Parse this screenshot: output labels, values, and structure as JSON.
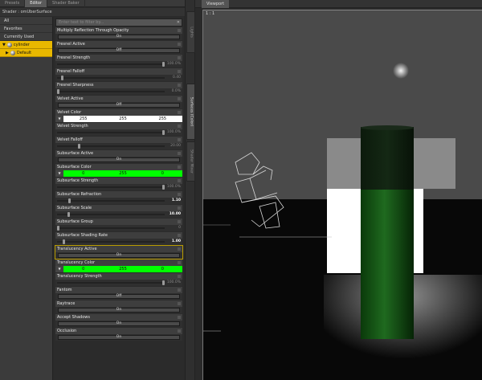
{
  "tabs": [
    {
      "label": "Presets",
      "active": false
    },
    {
      "label": "Editor",
      "active": true
    },
    {
      "label": "Shader Baker",
      "active": false
    }
  ],
  "shader_label": "Shader : omUberSurface",
  "categories": {
    "all": "All",
    "favorites": "Favorites",
    "currently_used": "Currently Used",
    "tree_root": "cylinder",
    "tree_child": "Default"
  },
  "search": {
    "placeholder": "Enter text to filter by..."
  },
  "props": {
    "multiply_reflection": {
      "label": "Multiply Reflection Through Opacity",
      "value": "On"
    },
    "fresnel_active": {
      "label": "Fresnel Active",
      "value": "Off"
    },
    "fresnel_strength": {
      "label": "Fresnel Strength",
      "value": "100.0%",
      "level": 1.0
    },
    "fresnel_falloff": {
      "label": "Fresnel Falloff",
      "value": "0.40",
      "level": 0.04
    },
    "fresnel_sharpness": {
      "label": "Fresnel Sharpness",
      "value": "0.0%",
      "level": 0.0
    },
    "velvet_active": {
      "label": "Velvet Active",
      "value": "Off"
    },
    "velvet_color": {
      "label": "Velvet Color",
      "r": "255",
      "g": "255",
      "b": "255",
      "hex": "#ffffff"
    },
    "velvet_strength": {
      "label": "Velvet Strength",
      "value": "100.0%",
      "level": 1.0
    },
    "velvet_falloff": {
      "label": "Velvet Falloff",
      "value": "20.00",
      "level": 0.2
    },
    "subsurface_active": {
      "label": "Subsurface Active",
      "value": "On"
    },
    "subsurface_color": {
      "label": "Subsurface Color",
      "r": "0",
      "g": "255",
      "b": "0",
      "hex": "#00ff00"
    },
    "subsurface_strength": {
      "label": "Subsurface Strength",
      "value": "100.0%",
      "level": 1.0
    },
    "subsurface_refraction": {
      "label": "Subsurface Refraction",
      "value": "1.10",
      "level": 0.11
    },
    "subsurface_scale": {
      "label": "Subsurface Scale",
      "value": "10.00",
      "level": 0.1
    },
    "subsurface_group": {
      "label": "Subsurface Group",
      "value": "0",
      "level": 0.0
    },
    "subsurface_shading_rate": {
      "label": "Subsurface Shading Rate",
      "value": "1.00",
      "level": 0.05
    },
    "translucency_active": {
      "label": "Translucency Active",
      "value": "On"
    },
    "translucency_color": {
      "label": "Translucency Color",
      "r": "0",
      "g": "255",
      "b": "0",
      "hex": "#00ff00"
    },
    "translucency_strength": {
      "label": "Translucency Strength",
      "value": "100.0%",
      "level": 1.0
    },
    "fantom": {
      "label": "Fantom",
      "value": "Off"
    },
    "raytrace": {
      "label": "Raytrace",
      "value": "On"
    },
    "accept_shadows": {
      "label": "Accept Shadows",
      "value": "On"
    },
    "occlusion": {
      "label": "Occlusion",
      "value": "On"
    }
  },
  "side_tabs": [
    "Lights",
    "Surfaces (Color)",
    "Shader Mixer"
  ],
  "viewport": {
    "tab": "Viewport",
    "ratio": "1 : 1"
  },
  "colors": {
    "selection": "#e8b800",
    "green": "#00ff00"
  }
}
